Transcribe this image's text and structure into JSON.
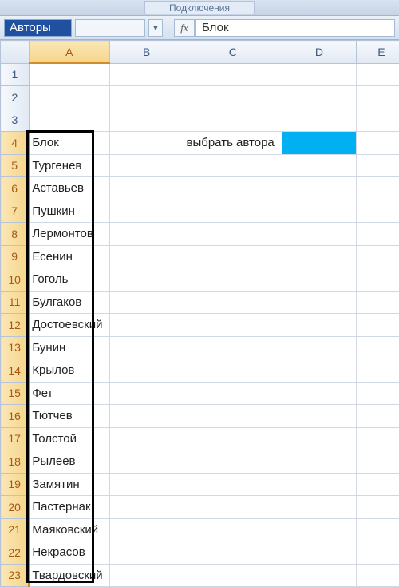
{
  "ribbon": {
    "group_label": "Подключения"
  },
  "formula_bar": {
    "name_box": "Авторы",
    "fx_label": "fx",
    "formula": "Блок"
  },
  "columns": [
    "A",
    "B",
    "C",
    "D",
    "E"
  ],
  "row_count": 23,
  "active_column": "A",
  "active_rows_from": 4,
  "active_rows_to": 23,
  "cells": {
    "C4": "выбрать автора",
    "A4": "Блок",
    "A5": "Тургенев",
    "A6": "Аставьев",
    "A7": "Пушкин",
    "A8": "Лермонтов",
    "A9": "Есенин",
    "A10": "Гоголь",
    "A11": "Булгаков",
    "A12": "Достоевский",
    "A13": "Бунин",
    "A14": "Крылов",
    "A15": "Фет",
    "A16": "Тютчев",
    "A17": "Толстой",
    "A18": "Рылеев",
    "A19": "Замятин",
    "A20": "Пастернак",
    "A21": "Маяковский",
    "A22": "Некрасов",
    "A23": "Твардовский"
  },
  "highlight_cell": "D4",
  "selection": {
    "col": "A",
    "row_start": 4,
    "row_end": 23
  }
}
